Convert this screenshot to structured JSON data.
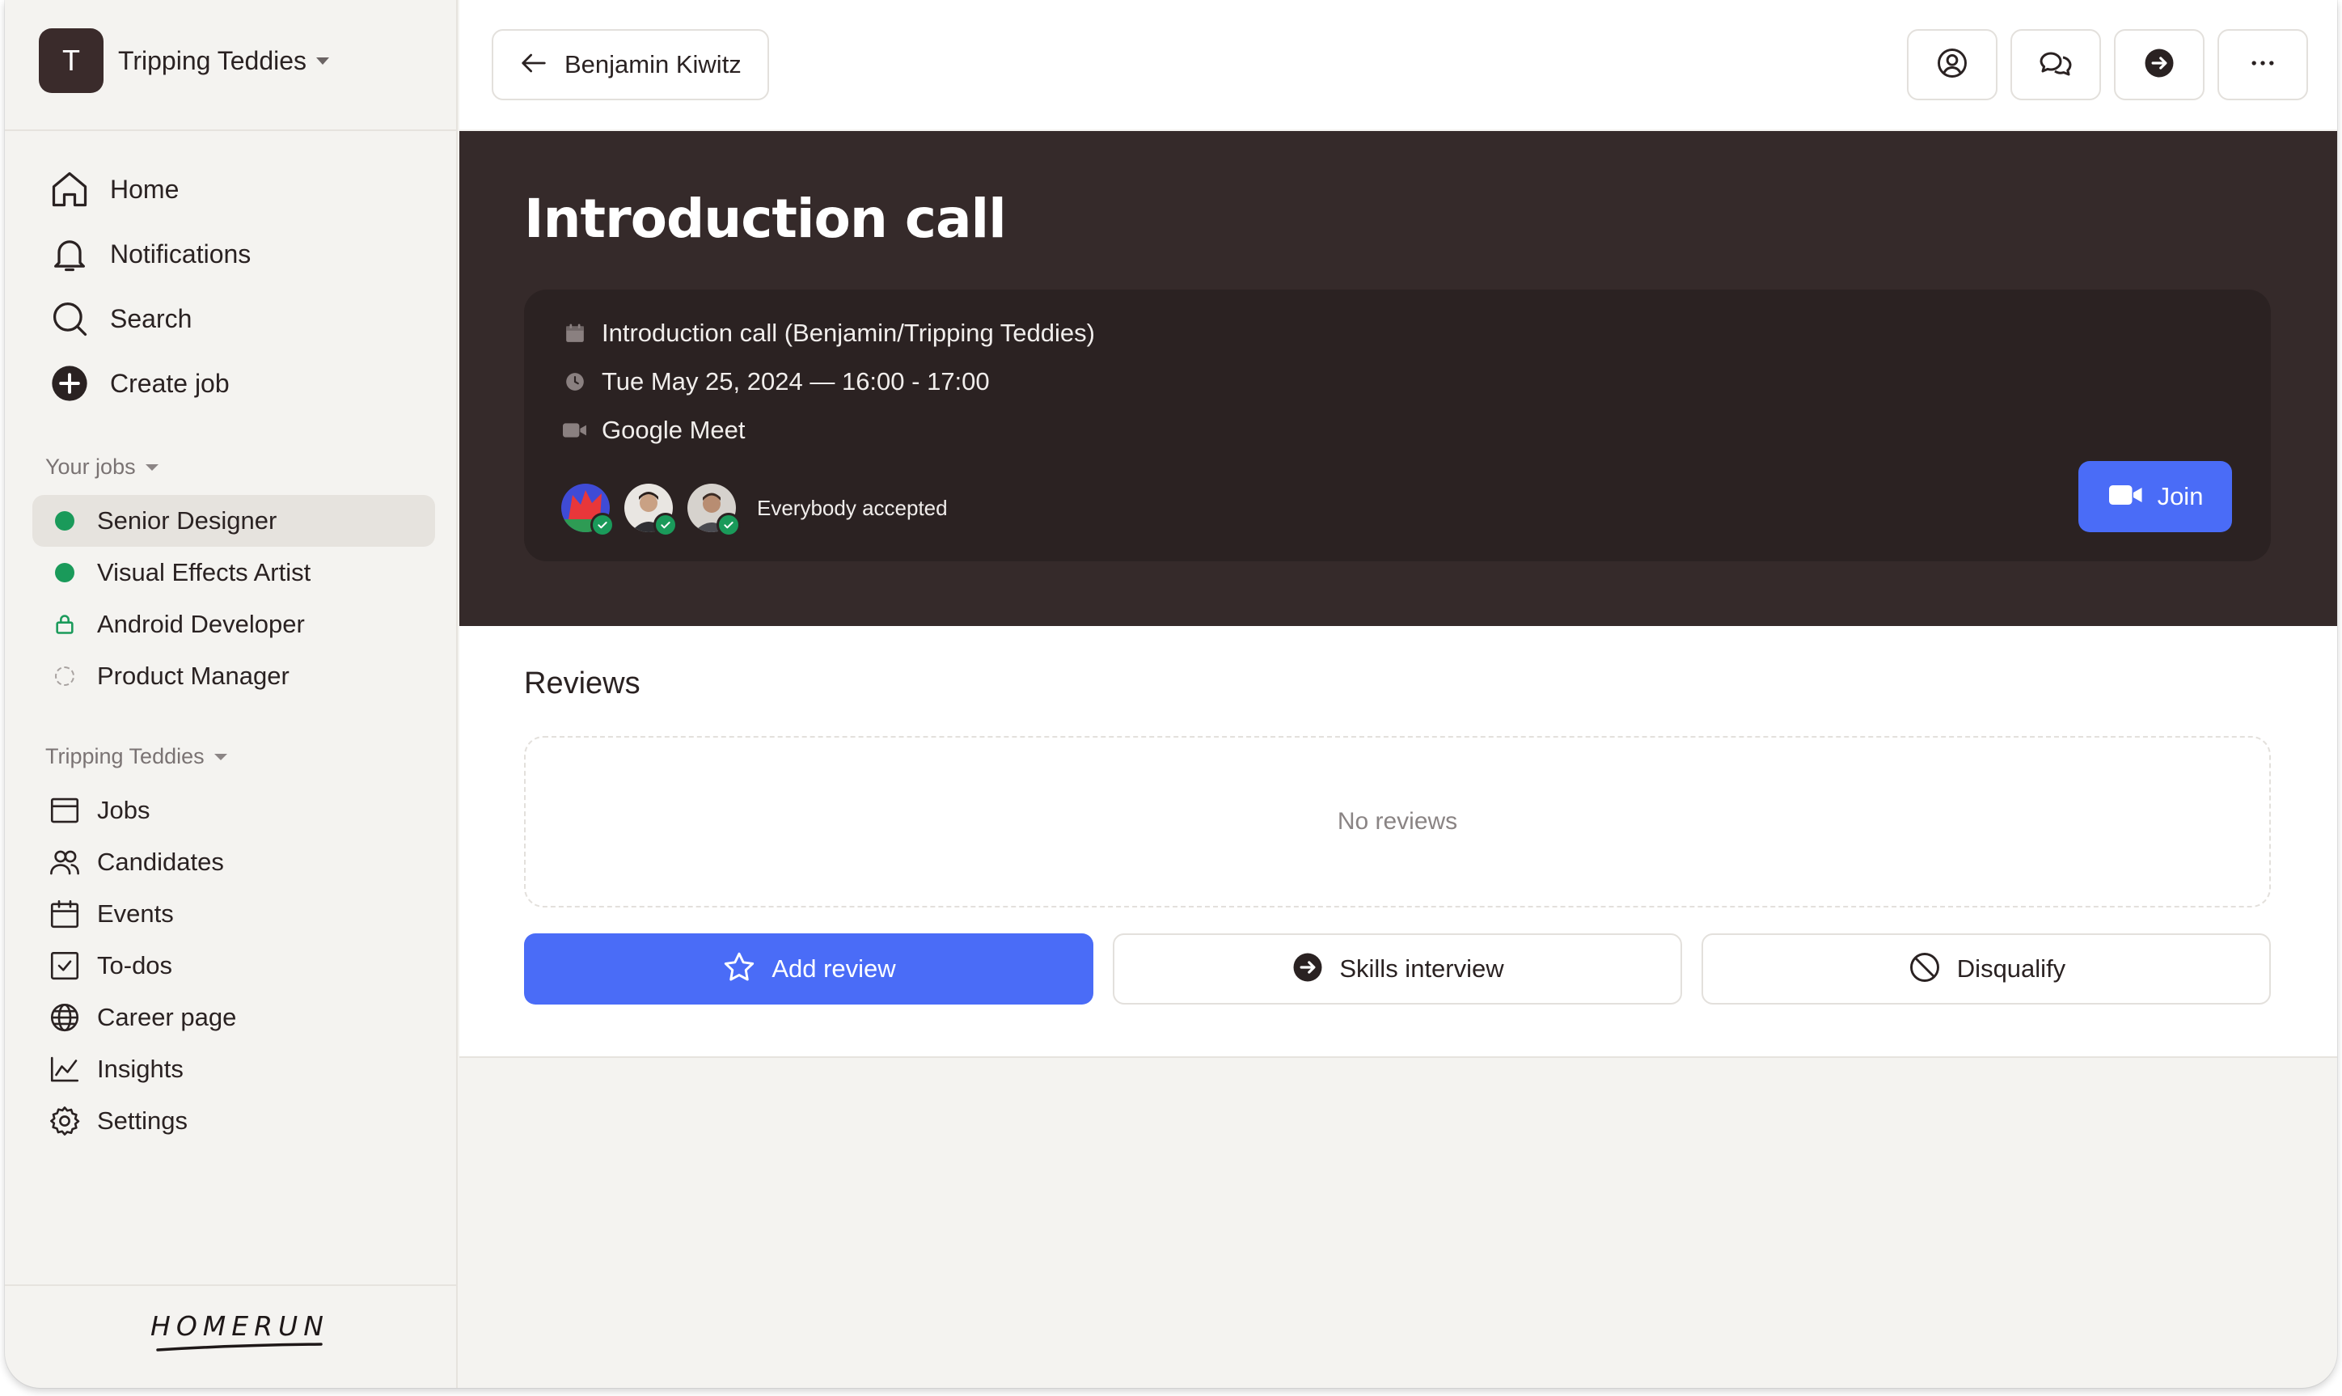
{
  "org": {
    "initial": "T",
    "name": "Tripping Teddies"
  },
  "nav": {
    "home": "Home",
    "notifications": "Notifications",
    "search": "Search",
    "create_job": "Create job"
  },
  "your_jobs": {
    "title": "Your jobs",
    "items": [
      {
        "label": "Senior Designer",
        "status": "active"
      },
      {
        "label": "Visual Effects Artist",
        "status": "active"
      },
      {
        "label": "Android Developer",
        "status": "locked"
      },
      {
        "label": "Product Manager",
        "status": "draft"
      }
    ]
  },
  "org_section": {
    "title": "Tripping Teddies",
    "items": [
      "Jobs",
      "Candidates",
      "Events",
      "To-dos",
      "Career page",
      "Insights",
      "Settings"
    ]
  },
  "logo": "HOMERUN",
  "topbar": {
    "back_label": "Benjamin Kiwitz",
    "icons": [
      "profile-icon",
      "chat-icon",
      "next-stage-icon",
      "more-icon"
    ]
  },
  "event": {
    "title": "Introduction call",
    "name": "Introduction call (Benjamin/Tripping Teddies)",
    "datetime": "Tue May 25, 2024 — 16:00 - 17:00",
    "location": "Google Meet",
    "attendees_status": "Everybody accepted",
    "join_label": "Join"
  },
  "reviews": {
    "title": "Reviews",
    "empty": "No reviews",
    "add_review": "Add review",
    "skills_interview": "Skills interview",
    "disqualify": "Disqualify"
  },
  "colors": {
    "accent": "#4a6cf7",
    "hero_bg": "#352a2a",
    "card_bg": "#2b2222",
    "success": "#1a9a5a",
    "sidebar_bg": "#f4f3f0"
  }
}
